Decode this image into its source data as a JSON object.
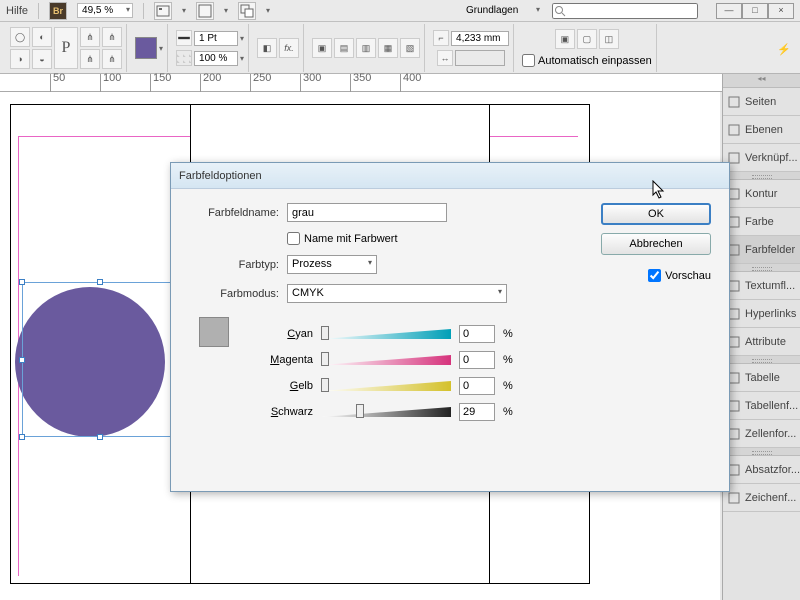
{
  "menubar": {
    "help": "Hilfe",
    "zoom": "49,5 %",
    "workspace": "Grundlagen",
    "search_placeholder": ""
  },
  "toolbar": {
    "stroke_weight": "1 Pt",
    "opacity": "100 %",
    "dim": "4,233 mm",
    "autofit_label": "Automatisch einpassen"
  },
  "ruler": {
    "marks": [
      "50",
      "100",
      "150",
      "200",
      "250",
      "300",
      "350",
      "400"
    ]
  },
  "panels": {
    "items": [
      {
        "label": "Seiten",
        "icon": "pages"
      },
      {
        "label": "Ebenen",
        "icon": "layers"
      },
      {
        "label": "Verknüpf...",
        "icon": "links"
      },
      {
        "label": "Kontur",
        "icon": "stroke"
      },
      {
        "label": "Farbe",
        "icon": "color"
      },
      {
        "label": "Farbfelder",
        "icon": "swatches",
        "active": true
      },
      {
        "label": "Textumfl...",
        "icon": "textwrap"
      },
      {
        "label": "Hyperlinks",
        "icon": "hyperlinks"
      },
      {
        "label": "Attribute",
        "icon": "attributes"
      },
      {
        "label": "Tabelle",
        "icon": "table"
      },
      {
        "label": "Tabellenf...",
        "icon": "tablestyles"
      },
      {
        "label": "Zellenfor...",
        "icon": "cellstyles"
      },
      {
        "label": "Absatzfor...",
        "icon": "parastyles"
      },
      {
        "label": "Zeichenf...",
        "icon": "charstyles"
      }
    ]
  },
  "dialog": {
    "title": "Farbfeldoptionen",
    "name_label": "Farbfeldname:",
    "name_value": "grau",
    "name_with_value": "Name mit Farbwert",
    "type_label": "Farbtyp:",
    "type_value": "Prozess",
    "mode_label": "Farbmodus:",
    "mode_value": "CMYK",
    "channels": [
      {
        "label": "Cyan",
        "value": "0",
        "pct": "%",
        "color": "#009fb7",
        "pos": 0
      },
      {
        "label": "Magenta",
        "value": "0",
        "pct": "%",
        "color": "#d6337c",
        "pos": 0
      },
      {
        "label": "Gelb",
        "value": "0",
        "pct": "%",
        "color": "#d4c12b",
        "pos": 0
      },
      {
        "label": "Schwarz",
        "value": "29",
        "pct": "%",
        "color": "#222",
        "pos": 29
      }
    ],
    "ok": "OK",
    "cancel": "Abbrechen",
    "preview": "Vorschau"
  }
}
